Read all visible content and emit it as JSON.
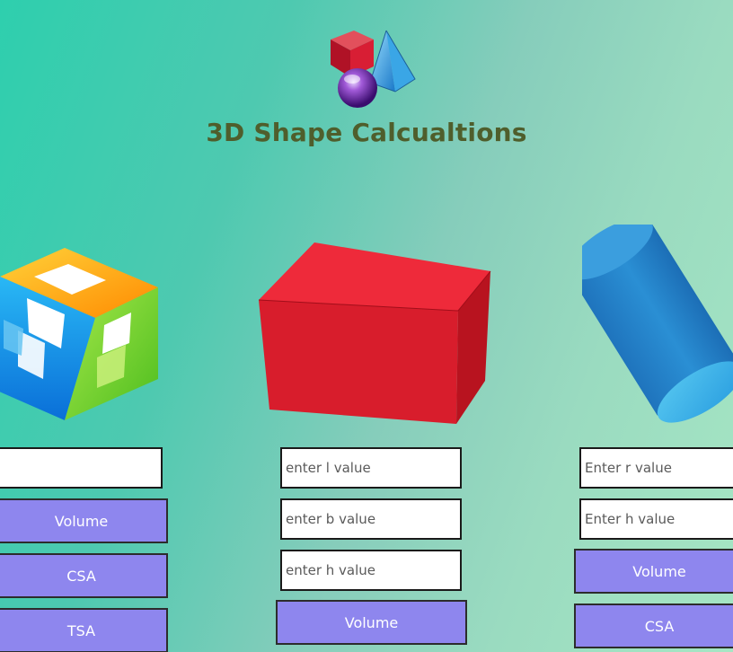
{
  "app": {
    "title": "3D Shape Calcualtions"
  },
  "icons": {
    "logo": "3d-shapes-logo-icon",
    "cube": "cube-image",
    "cuboid": "cuboid-image",
    "cylinder": "cylinder-image"
  },
  "cube_panel": {
    "side_input": {
      "value": "",
      "placeholder": ""
    },
    "volume_label": "Volume",
    "csa_label": "CSA",
    "tsa_label": "TSA"
  },
  "cuboid_panel": {
    "l_input": {
      "value": "",
      "placeholder": "enter l value"
    },
    "b_input": {
      "value": "",
      "placeholder": "enter b value"
    },
    "h_input": {
      "value": "",
      "placeholder": "enter h value"
    },
    "volume_label": "Volume"
  },
  "cylinder_panel": {
    "r_input": {
      "value": "",
      "placeholder": "Enter r value"
    },
    "h_input": {
      "value": "",
      "placeholder": "Enter h value"
    },
    "volume_label": "Volume",
    "csa_label": "CSA"
  },
  "colors": {
    "button_fill": "#8e86ee",
    "title_text": "#4f5e2c",
    "cuboid_red": "#e01e2e",
    "cylinder_blue": "#2f8ed0"
  }
}
